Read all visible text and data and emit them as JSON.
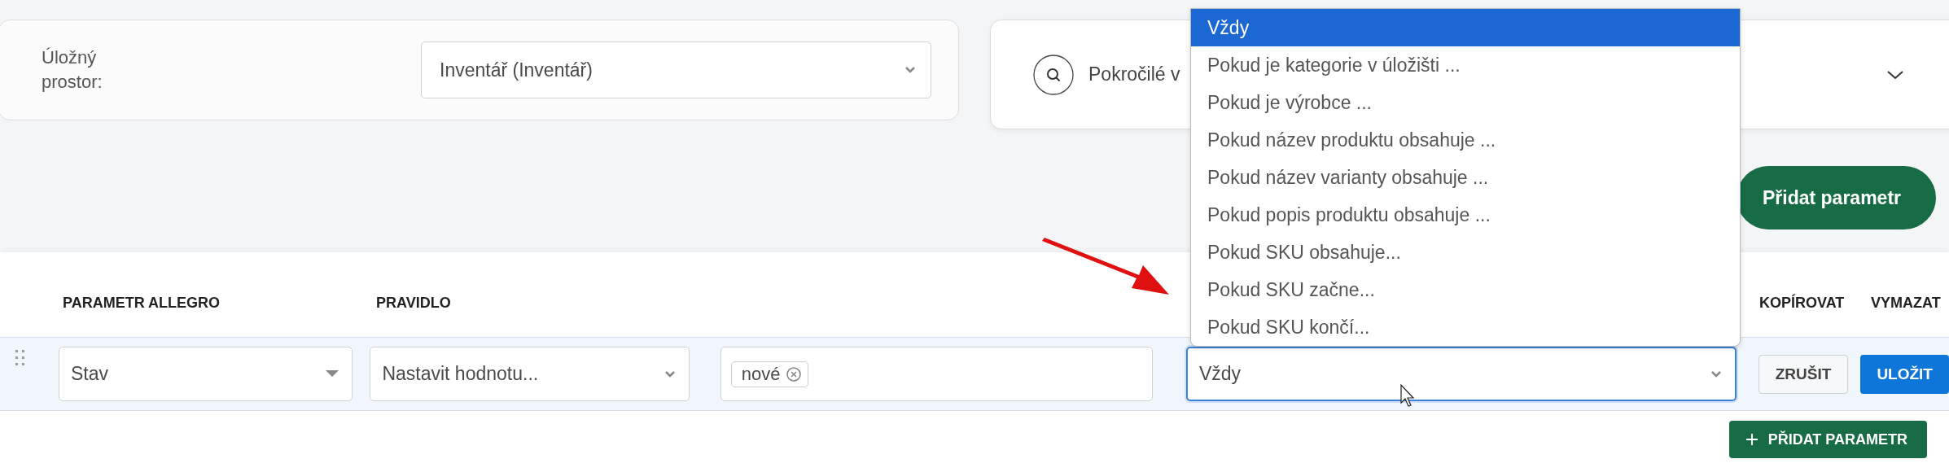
{
  "storage": {
    "label": "Úložný prostor:",
    "value": "Inventář (Inventář)"
  },
  "advanced_search": {
    "label": "Pokročilé v"
  },
  "add_parameter_top": "Přidat parametr",
  "table": {
    "columns": [
      "PARAMETR ALLEGRO",
      "PRAVIDLO",
      "KOPÍROVAT",
      "VYMAZAT"
    ],
    "row": {
      "parameter": "Stav",
      "rule": "Nastavit hodnotu...",
      "tags": [
        "nové"
      ],
      "condition": "Vždy",
      "cancel": "ZRUŠIT",
      "save": "ULOŽIT"
    }
  },
  "dropdown": {
    "options": [
      {
        "label": "Vždy",
        "selected": true
      },
      {
        "label": "Pokud je kategorie v úložišti ...",
        "selected": false
      },
      {
        "label": "Pokud je výrobce ...",
        "selected": false
      },
      {
        "label": "Pokud název produktu obsahuje ...",
        "selected": false
      },
      {
        "label": "Pokud název varianty obsahuje ...",
        "selected": false
      },
      {
        "label": "Pokud popis produktu obsahuje ...",
        "selected": false
      },
      {
        "label": "Pokud SKU obsahuje...",
        "selected": false
      },
      {
        "label": "Pokud SKU začne...",
        "selected": false
      },
      {
        "label": "Pokud SKU končí...",
        "selected": false
      }
    ]
  },
  "add_parameter_button": "PŘIDAT PARAMETR"
}
